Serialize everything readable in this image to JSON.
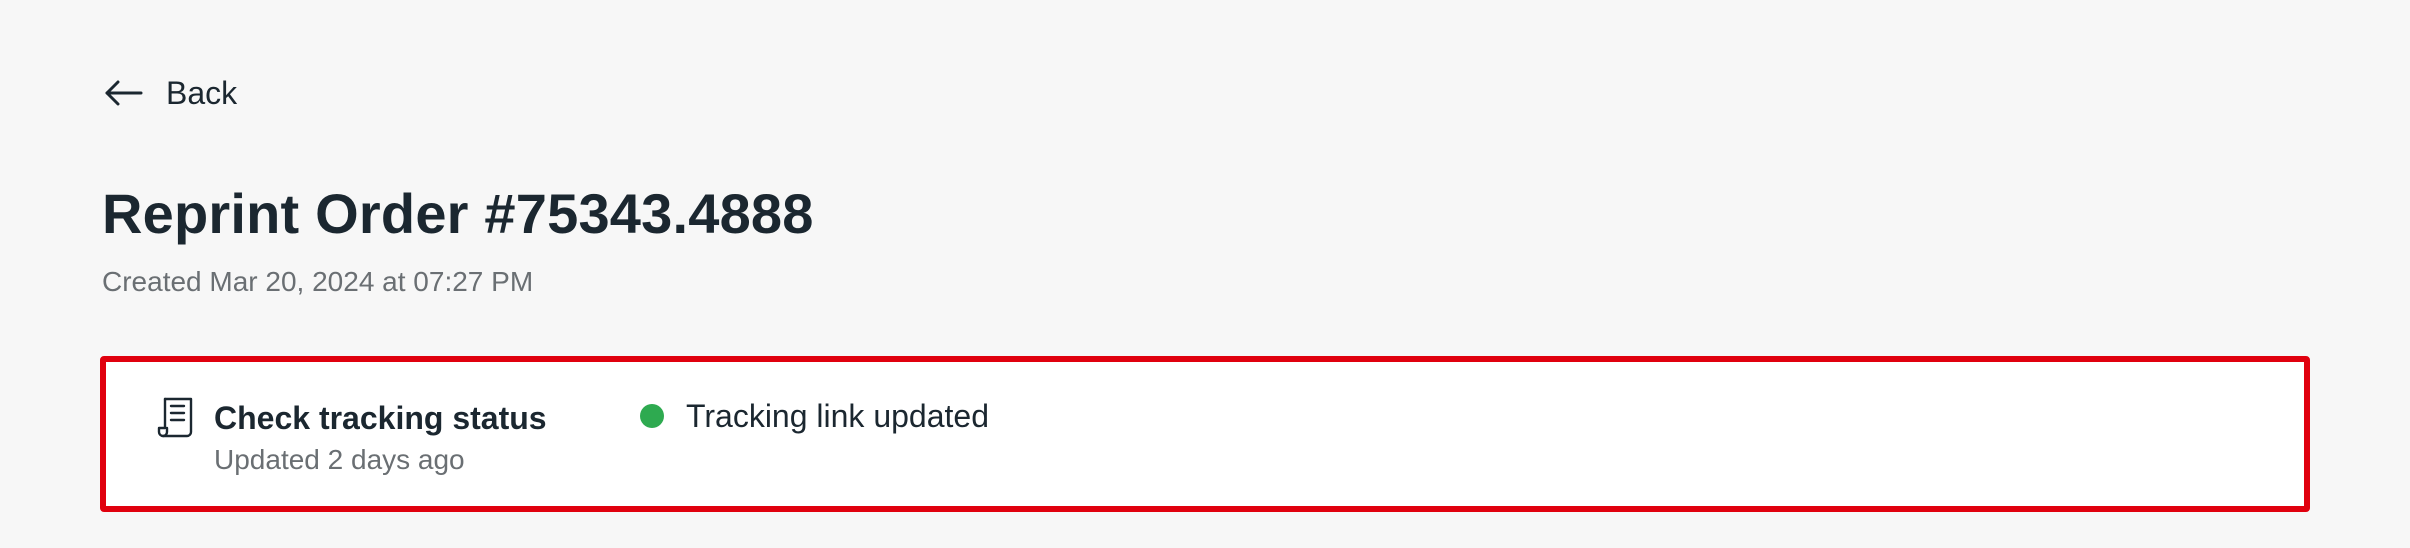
{
  "nav": {
    "back_label": "Back",
    "back_icon": "arrow-left-icon"
  },
  "header": {
    "title": "Reprint Order #75343.4888",
    "subtitle": "Created Mar 20, 2024 at 07:27 PM"
  },
  "tracking_card": {
    "icon": "receipt-icon",
    "title": "Check tracking status",
    "updated": "Updated 2 days ago",
    "status_label": "Tracking link updated",
    "status_color": "#2eaa50",
    "highlight_color": "#e0000e"
  }
}
